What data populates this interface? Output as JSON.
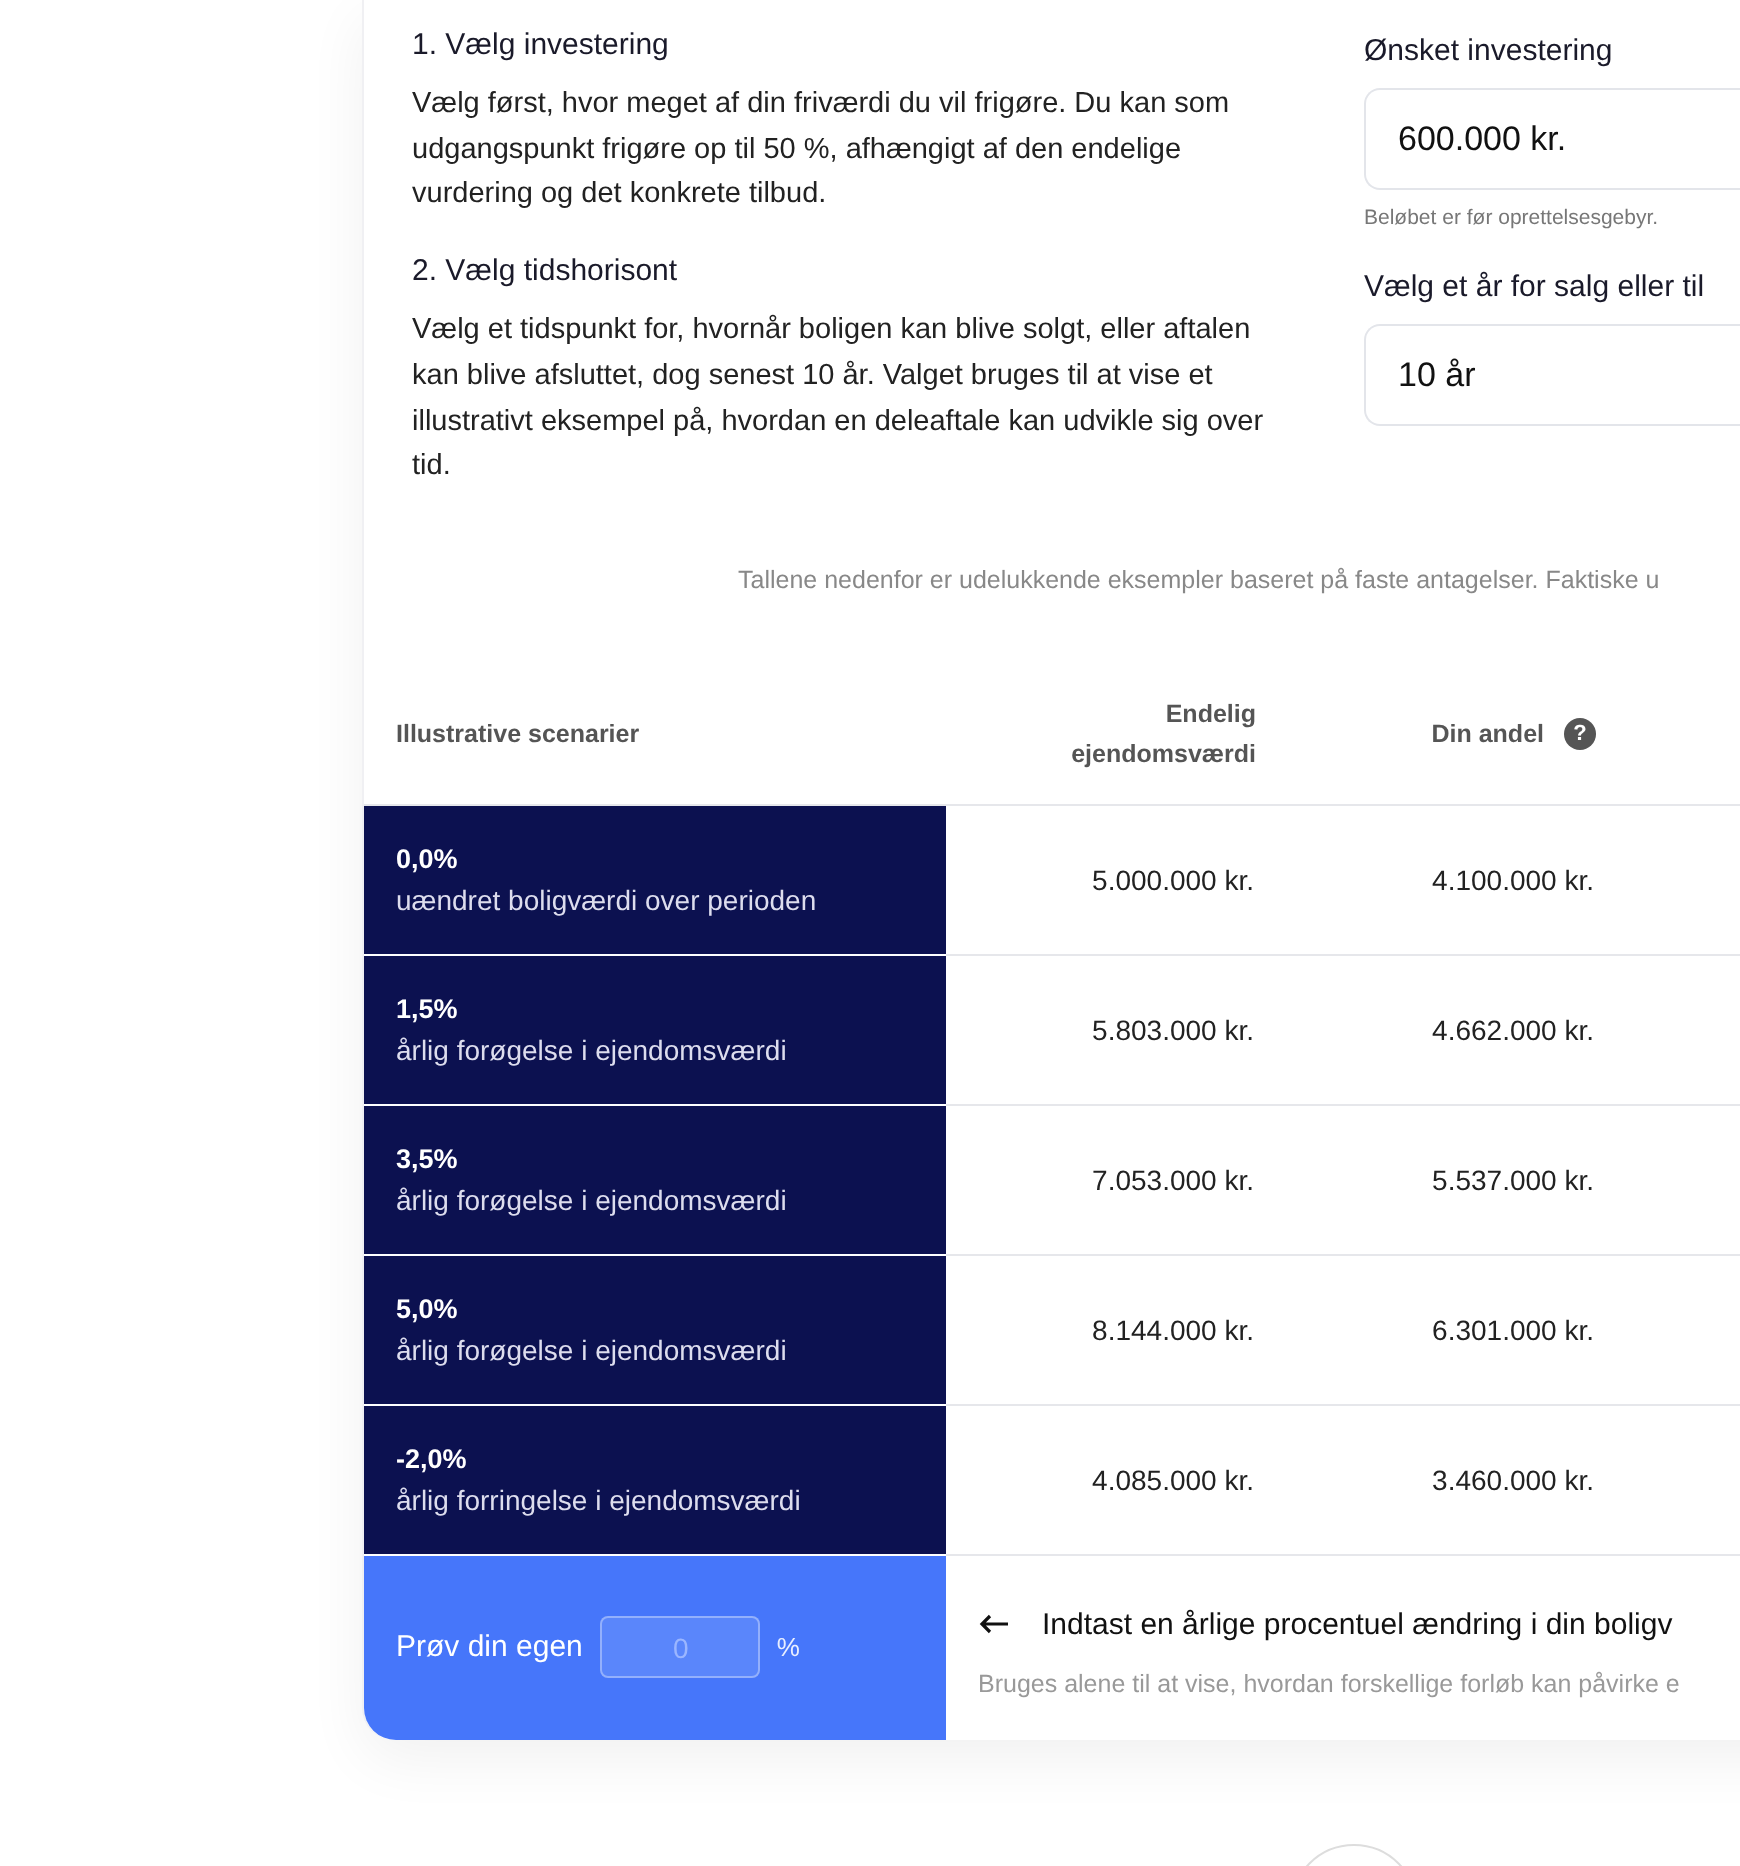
{
  "steps": [
    {
      "title": "1. Vælg investering",
      "text": "Vælg først, hvor meget af din friværdi du vil frigøre. Du kan som udgangspunkt frigøre op til 50 %, afhængigt af den endelige vurdering og det konkrete tilbud."
    },
    {
      "title": "2. Vælg tidshorisont",
      "text": "Vælg et tidspunkt for, hvornår boligen kan blive solgt, eller aftalen kan blive afsluttet, dog senest 10 år. Valget bruges til at vise et illustrativt eksempel på, hvordan en deleaftale kan udvikle sig over tid."
    }
  ],
  "fields": [
    {
      "label": "Ønsket investering",
      "value": "600.000 kr.",
      "hint": "Beløbet er før oprettelsesgebyr."
    },
    {
      "label": "Vælg et år for salg eller til",
      "value": "10 år"
    }
  ],
  "disclaimer": "Tallene nedenfor er udelukkende eksempler baseret på faste antagelser. Faktiske u",
  "table": {
    "columns": [
      {
        "label": "Illustrative scenarier"
      },
      {
        "label": "Endelig ejendomsværdi"
      },
      {
        "label": "Din andel",
        "help": "?"
      }
    ],
    "rows": [
      {
        "rate": "0,0%",
        "description": "uændret boligværdi over perioden",
        "values": [
          "5.000.000 kr.",
          "4.100.000 kr."
        ]
      },
      {
        "rate": "1,5%",
        "description": "årlig forøgelse i ejendomsværdi",
        "values": [
          "5.803.000 kr.",
          "4.662.000 kr."
        ]
      },
      {
        "rate": "3,5%",
        "description": "årlig forøgelse i ejendomsværdi",
        "values": [
          "7.053.000 kr.",
          "5.537.000 kr."
        ]
      },
      {
        "rate": "5,0%",
        "description": "årlig forøgelse i ejendomsværdi",
        "values": [
          "8.144.000 kr.",
          "6.301.000 kr."
        ]
      },
      {
        "rate": "-2,0%",
        "description": "årlig forringelse i ejendomsværdi",
        "values": [
          "4.085.000 kr.",
          "3.460.000 kr."
        ]
      }
    ]
  },
  "custom": {
    "label": "Prøv din egen",
    "placeholder": "0",
    "unit": "%",
    "instruction": "Indtast en årlige procentuel ændring i din boligv",
    "note": "Bruges alene til at vise, hvordan forskellige forløb kan påvirke e"
  }
}
